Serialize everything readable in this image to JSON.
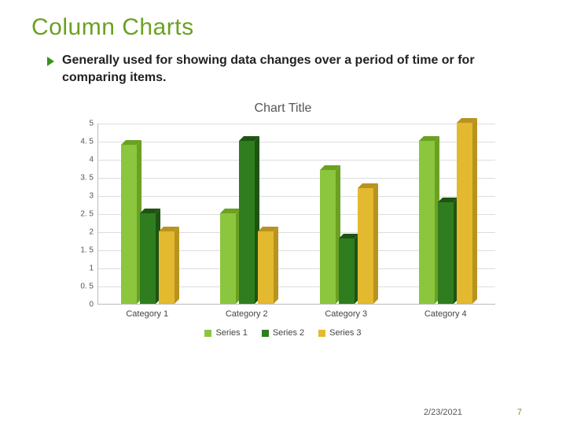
{
  "title": "Column Charts",
  "bullet": "Generally used for showing data changes over a period of time or for comparing items.",
  "chart_data": {
    "type": "bar",
    "title": "Chart Title",
    "categories": [
      "Category 1",
      "Category 2",
      "Category 3",
      "Category 4"
    ],
    "series": [
      {
        "name": "Series 1",
        "values": [
          4.4,
          2.5,
          3.7,
          4.5
        ],
        "color": "#8cc63f",
        "shade": "#6aa121"
      },
      {
        "name": "Series 2",
        "values": [
          2.5,
          4.5,
          1.8,
          2.8
        ],
        "color": "#2f7d1f",
        "shade": "#1e5413"
      },
      {
        "name": "Series 3",
        "values": [
          2.0,
          2.0,
          3.2,
          5.0
        ],
        "color": "#e3b92f",
        "shade": "#b8931f"
      }
    ],
    "ylim": [
      0,
      5
    ],
    "yticks": [
      0,
      0.5,
      1,
      1.5,
      2,
      2.5,
      3,
      3.5,
      4,
      4.5,
      5
    ],
    "xlabel": "",
    "ylabel": ""
  },
  "footer": {
    "date": "2/23/2021",
    "page": "7"
  }
}
